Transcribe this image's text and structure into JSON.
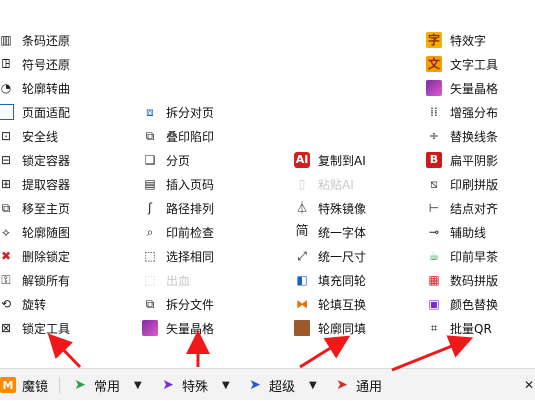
{
  "colors": {
    "arrow": "#f01818",
    "toolbar_bg": "#f3f3f3"
  },
  "menus": {
    "col1": [
      {
        "label": "条码还原",
        "icon": "barcode-icon",
        "disabled": false
      },
      {
        "label": "符号还原",
        "icon": "symbol-icon",
        "disabled": false
      },
      {
        "label": "轮廓转曲",
        "icon": "outline-curve-icon",
        "disabled": false
      },
      {
        "label": "页面适配",
        "icon": "page-fit-icon",
        "disabled": false
      },
      {
        "label": "安全线",
        "icon": "safety-line-icon",
        "disabled": false
      },
      {
        "label": "锁定容器",
        "icon": "lock-container-icon",
        "disabled": false
      },
      {
        "label": "提取容器",
        "icon": "extract-container-icon",
        "disabled": false
      },
      {
        "label": "移至主页",
        "icon": "move-home-icon",
        "disabled": false
      },
      {
        "label": "轮廓随图",
        "icon": "outline-follow-icon",
        "disabled": false
      },
      {
        "label": "删除锁定",
        "icon": "delete-lock-icon",
        "disabled": false
      },
      {
        "label": "解锁所有",
        "icon": "unlock-all-icon",
        "disabled": false
      },
      {
        "label": "旋转",
        "icon": "rotate-icon",
        "disabled": false
      },
      {
        "label": "锁定工具",
        "icon": "lock-tool-icon",
        "disabled": false
      }
    ],
    "col2": [
      {
        "label": "拆分对页",
        "icon": "split-spread-icon",
        "disabled": false
      },
      {
        "label": "叠印陷印",
        "icon": "overprint-trap-icon",
        "disabled": false
      },
      {
        "label": "分页",
        "icon": "paginate-icon",
        "disabled": false
      },
      {
        "label": "插入页码",
        "icon": "insert-page-number-icon",
        "disabled": false
      },
      {
        "label": "路径排列",
        "icon": "path-arrange-icon",
        "disabled": false
      },
      {
        "label": "印前检查",
        "icon": "preflight-icon",
        "disabled": false
      },
      {
        "label": "选择相同",
        "icon": "select-same-icon",
        "disabled": false
      },
      {
        "label": "出血",
        "icon": "bleed-icon",
        "disabled": true
      },
      {
        "label": "拆分文件",
        "icon": "split-file-icon",
        "disabled": false
      },
      {
        "label": "矢量晶格",
        "icon": "vector-lattice-icon",
        "disabled": false
      }
    ],
    "col3": [
      {
        "label": "复制到AI",
        "icon": "copy-to-ai-icon",
        "disabled": false
      },
      {
        "label": "粘贴AI",
        "icon": "paste-ai-icon",
        "disabled": true
      },
      {
        "label": "特殊镜像",
        "icon": "special-mirror-icon",
        "disabled": false
      },
      {
        "label": "统一字体",
        "icon": "unify-font-icon",
        "disabled": false
      },
      {
        "label": "统一尺寸",
        "icon": "unify-size-icon",
        "disabled": false
      },
      {
        "label": "填充同轮",
        "icon": "fill-same-outline-icon",
        "disabled": false
      },
      {
        "label": "轮填互换",
        "icon": "outline-fill-swap-icon",
        "disabled": false
      },
      {
        "label": "轮廓同填",
        "icon": "outline-same-fill-icon",
        "disabled": false
      }
    ],
    "col4": [
      {
        "label": "特效字",
        "icon": "effect-text-icon",
        "disabled": false
      },
      {
        "label": "文字工具",
        "icon": "text-tool-icon",
        "disabled": false
      },
      {
        "label": "矢量晶格",
        "icon": "vector-lattice-icon",
        "disabled": false
      },
      {
        "label": "增强分布",
        "icon": "enhanced-distribute-icon",
        "disabled": false
      },
      {
        "label": "替换线条",
        "icon": "replace-line-icon",
        "disabled": false
      },
      {
        "label": "扁平阴影",
        "icon": "flat-shadow-icon",
        "disabled": false
      },
      {
        "label": "印刷拼版",
        "icon": "print-imposition-icon",
        "disabled": false
      },
      {
        "label": "结点对齐",
        "icon": "node-align-icon",
        "disabled": false
      },
      {
        "label": "辅助线",
        "icon": "guide-line-icon",
        "disabled": false
      },
      {
        "label": "印前早茶",
        "icon": "prepress-tea-icon",
        "disabled": false
      },
      {
        "label": "数码拼版",
        "icon": "digital-imposition-icon",
        "disabled": false
      },
      {
        "label": "颜色替换",
        "icon": "color-replace-icon",
        "disabled": false
      },
      {
        "label": "批量QR",
        "icon": "batch-qr-icon",
        "disabled": false
      }
    ]
  },
  "toolbar": {
    "mirror_label": "魔镜",
    "common_label": "常用",
    "special_label": "特殊",
    "advanced_label": "超级",
    "general_label": "通用"
  }
}
